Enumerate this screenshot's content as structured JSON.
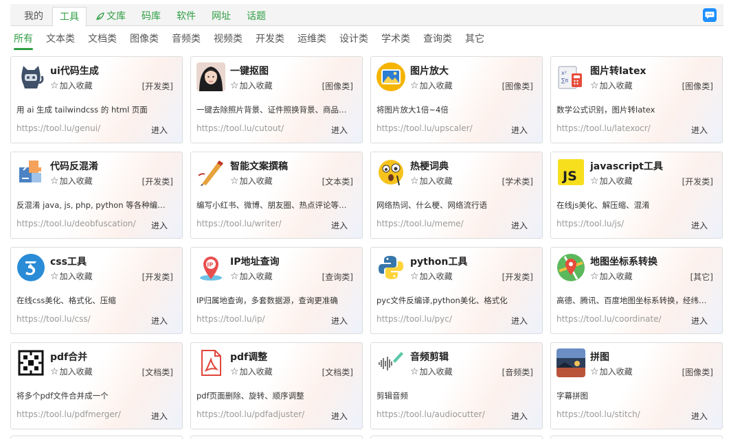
{
  "topnav": {
    "tabs": [
      {
        "label": "我的",
        "state": "normal"
      },
      {
        "label": "工具",
        "state": "active"
      },
      {
        "label": "文库",
        "state": "green",
        "icon": "leaf-icon"
      },
      {
        "label": "码库",
        "state": "green"
      },
      {
        "label": "软件",
        "state": "green"
      },
      {
        "label": "网址",
        "state": "green"
      },
      {
        "label": "话题",
        "state": "green"
      }
    ],
    "chat_icon": "chat-bubble-icon"
  },
  "categories": [
    "所有",
    "文本类",
    "文档类",
    "图像类",
    "音频类",
    "视频类",
    "开发类",
    "运维类",
    "设计类",
    "学术类",
    "查询类",
    "其它"
  ],
  "active_category": "所有",
  "colors": {
    "accent_green": "#2f9e44",
    "chat_blue": "#1e90ff"
  },
  "fav_label": "加入收藏",
  "enter_label": "进入",
  "cards": [
    {
      "name": "ui代码生成",
      "type": "[开发类]",
      "desc": "用 ai 生成 tailwindcss 的 html 页面",
      "url": "https://tool.lu/genui/",
      "icon": "cat-mascot-icon"
    },
    {
      "name": "一键抠图",
      "type": "[图像类]",
      "desc": "一键去除照片背景、证件照换背景、商品白底图",
      "url": "https://tool.lu/cutout/",
      "icon": "portrait-photo-icon"
    },
    {
      "name": "图片放大",
      "type": "[图像类]",
      "desc": "将图片放大1倍~4倍",
      "url": "https://tool.lu/upscaler/",
      "icon": "image-frame-icon"
    },
    {
      "name": "图片转latex",
      "type": "[图像类]",
      "desc": "数学公式识别，图片转latex",
      "url": "https://tool.lu/latexocr/",
      "icon": "math-formula-icon"
    },
    {
      "name": "代码反混淆",
      "type": "[开发类]",
      "desc": "反混淆 java, js, php, python 等各种编程语言",
      "url": "https://tool.lu/deobfuscation/",
      "icon": "puzzle-pieces-icon"
    },
    {
      "name": "智能文案撰稿",
      "type": "[文本类]",
      "desc": "编写小红书、微博、朋友圈、热点评论等文案",
      "url": "https://tool.lu/writer/",
      "icon": "pen-writing-icon"
    },
    {
      "name": "热梗词典",
      "type": "[学术类]",
      "desc": "网络热词、什么梗、网络流行语",
      "url": "https://tool.lu/meme/",
      "icon": "surprised-emoji-icon"
    },
    {
      "name": "javascript工具",
      "type": "[开发类]",
      "desc": "在线js美化、解压缩、混淆",
      "url": "https://tool.lu/js/",
      "icon": "js-logo-icon"
    },
    {
      "name": "css工具",
      "type": "[开发类]",
      "desc": "在线css美化、格式化、压缩",
      "url": "https://tool.lu/css/",
      "icon": "css3-logo-icon"
    },
    {
      "name": "IP地址查询",
      "type": "[查询类]",
      "desc": "IP归属地查询，多套数据源，查询更准确",
      "url": "https://tool.lu/ip/",
      "icon": "location-pin-icon"
    },
    {
      "name": "python工具",
      "type": "[开发类]",
      "desc": "pyc文件反编译,python美化、格式化",
      "url": "https://tool.lu/pyc/",
      "icon": "python-logo-icon"
    },
    {
      "name": "地图坐标系转换",
      "type": "[其它]",
      "desc": "高德、腾讯、百度地图坐标系转换，经纬度转换",
      "url": "https://tool.lu/coordinate/",
      "icon": "map-pin-icon"
    },
    {
      "name": "pdf合并",
      "type": "[文档类]",
      "desc": "将多个pdf文件合并成一个",
      "url": "https://tool.lu/pdfmerger/",
      "icon": "merge-blocks-icon"
    },
    {
      "name": "pdf调整",
      "type": "[文档类]",
      "desc": "pdf页面删除、旋转、顺序调整",
      "url": "https://tool.lu/pdfadjuster/",
      "icon": "pdf-document-icon"
    },
    {
      "name": "音频剪辑",
      "type": "[音频类]",
      "desc": "剪辑音频",
      "url": "https://tool.lu/audiocutter/",
      "icon": "audio-waveform-icon"
    },
    {
      "name": "拼图",
      "type": "[图像类]",
      "desc": "字幕拼图",
      "url": "https://tool.lu/stitch/",
      "icon": "stitched-photo-icon"
    }
  ]
}
